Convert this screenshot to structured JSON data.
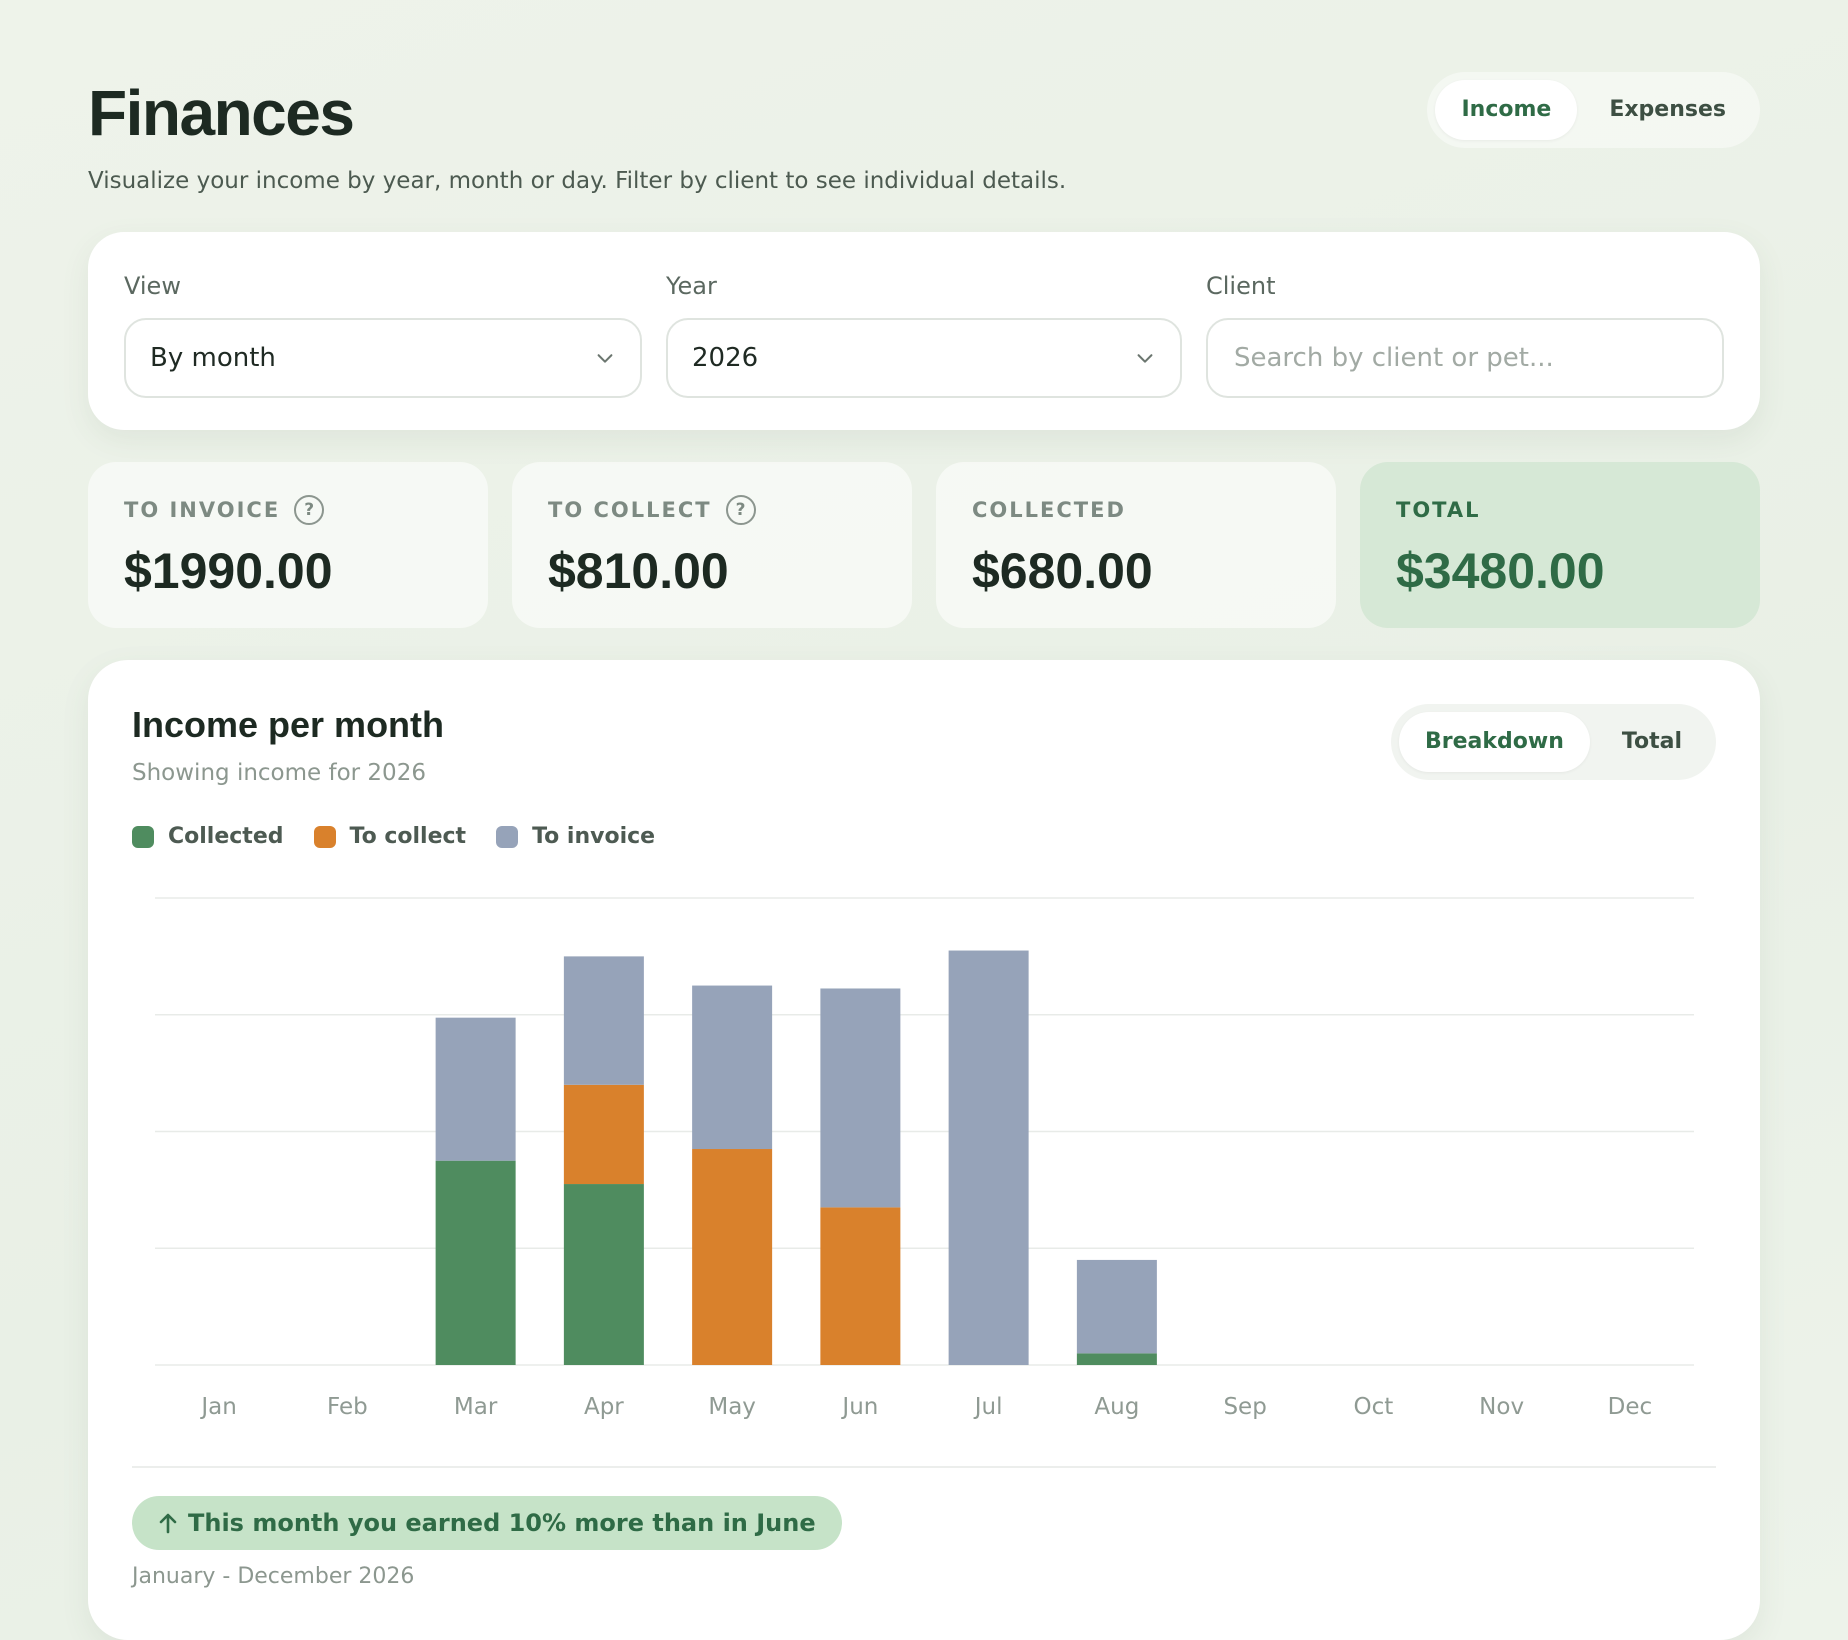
{
  "header": {
    "title": "Finances",
    "subtitle": "Visualize your income by year, month or day. Filter by client to see individual details.",
    "tabs": [
      {
        "label": "Income",
        "active": true
      },
      {
        "label": "Expenses",
        "active": false
      }
    ]
  },
  "filters": {
    "view": {
      "label": "View",
      "value": "By month"
    },
    "year": {
      "label": "Year",
      "value": "2026"
    },
    "client": {
      "label": "Client",
      "value": "",
      "placeholder": "Search by client or pet..."
    }
  },
  "stats": [
    {
      "label": "TO INVOICE",
      "value": "$1990.00",
      "help": true
    },
    {
      "label": "TO COLLECT",
      "value": "$810.00",
      "help": true
    },
    {
      "label": "COLLECTED",
      "value": "$680.00",
      "help": false
    },
    {
      "label": "TOTAL",
      "value": "$3480.00",
      "help": false
    }
  ],
  "chart_card": {
    "title": "Income per month",
    "subtitle": "Showing income for 2026",
    "modes": [
      {
        "label": "Breakdown",
        "active": true
      },
      {
        "label": "Total",
        "active": false
      }
    ],
    "insight": "This month you earned 10% more than in June",
    "range": "January - December 2026"
  },
  "colors": {
    "collected": "#4f8c5f",
    "to_collect": "#d9812c",
    "to_invoice": "#96a3b9",
    "accent": "#2f6b46"
  },
  "chart_data": {
    "type": "bar",
    "stacked": true,
    "categories": [
      "Jan",
      "Feb",
      "Mar",
      "Apr",
      "May",
      "Jun",
      "Jul",
      "Aug",
      "Sep",
      "Oct",
      "Nov",
      "Dec"
    ],
    "series": [
      {
        "name": "Collected",
        "values": [
          0,
          0,
          350,
          310,
          0,
          0,
          0,
          20,
          0,
          0,
          0,
          0
        ]
      },
      {
        "name": "To collect",
        "values": [
          0,
          0,
          0,
          170,
          370,
          270,
          0,
          0,
          0,
          0,
          0,
          0
        ]
      },
      {
        "name": "To invoice",
        "values": [
          0,
          0,
          245,
          220,
          280,
          375,
          710,
          160,
          0,
          0,
          0,
          0
        ]
      }
    ],
    "ylim": [
      0,
      800
    ],
    "grid": true,
    "legend": "top-left",
    "title": "Income per month",
    "xlabel": "",
    "ylabel": ""
  }
}
